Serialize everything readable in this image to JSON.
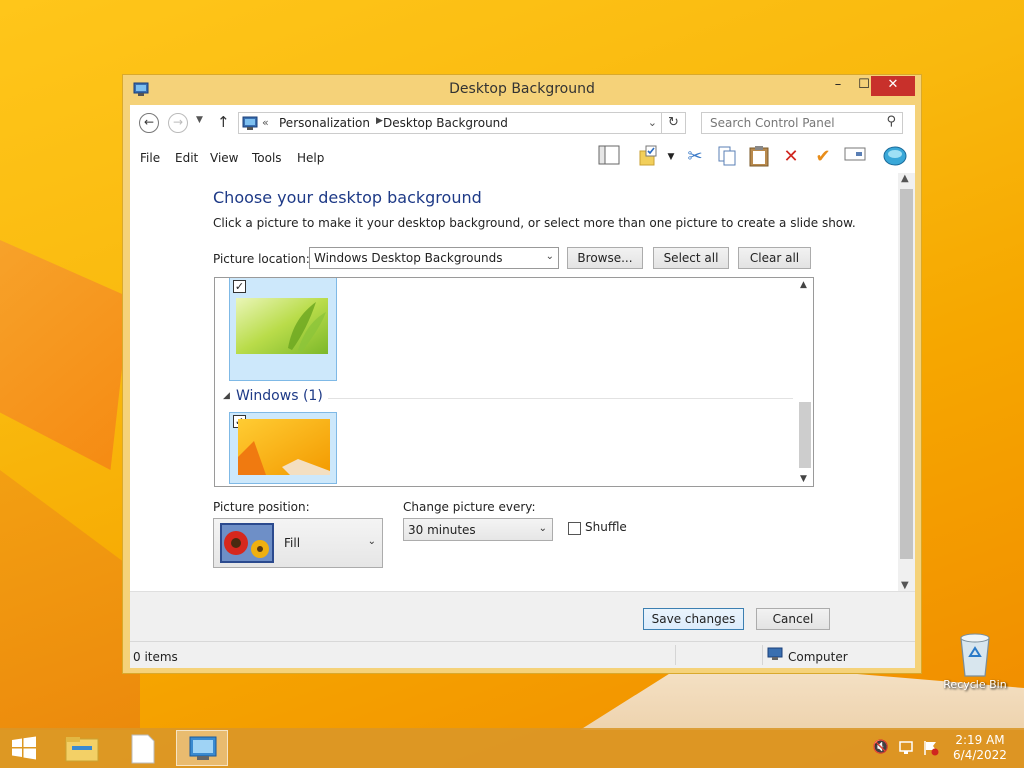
{
  "window": {
    "title": "Desktop Background",
    "controls": {
      "minimize": "–",
      "maximize": "☐",
      "close": "✕"
    }
  },
  "address": {
    "overflow": "«",
    "crumbs": [
      "Personalization",
      "Desktop Background"
    ],
    "search_placeholder": "Search Control Panel"
  },
  "menu": [
    "File",
    "Edit",
    "View",
    "Tools",
    "Help"
  ],
  "toolbar_icons": [
    "layout-icon",
    "folder-check-icon",
    "dropdown-icon",
    "cut-icon",
    "copy-icon",
    "paste-icon",
    "delete-icon",
    "properties-icon",
    "rename-icon",
    "globe-icon"
  ],
  "content": {
    "heading": "Choose your desktop background",
    "subtitle": "Click a picture to make it your desktop background, or select more than one picture to create a slide show.",
    "location_label": "Picture location:",
    "location_value": "Windows Desktop Backgrounds",
    "browse": "Browse...",
    "select_all": "Select all",
    "clear_all": "Clear all",
    "group_label": "Windows (1)",
    "thumbnails": [
      {
        "name": "green-leaves-wallpaper",
        "checked": true
      },
      {
        "name": "orange-windows-wallpaper",
        "checked": true
      }
    ],
    "position_label": "Picture position:",
    "position_value": "Fill",
    "interval_label": "Change picture every:",
    "interval_value": "30 minutes",
    "shuffle_label": "Shuffle",
    "shuffle_checked": false
  },
  "footer": {
    "save": "Save changes",
    "cancel": "Cancel"
  },
  "status": {
    "items": "0 items",
    "location": "Computer"
  },
  "desktop": {
    "recycle_bin": "Recycle Bin"
  },
  "taskbar": {
    "time": "2:19 AM",
    "date": "6/4/2022"
  },
  "colors": {
    "accent": "#1e3a87",
    "close": "#c8302b",
    "window_frame": "#f5d279"
  }
}
